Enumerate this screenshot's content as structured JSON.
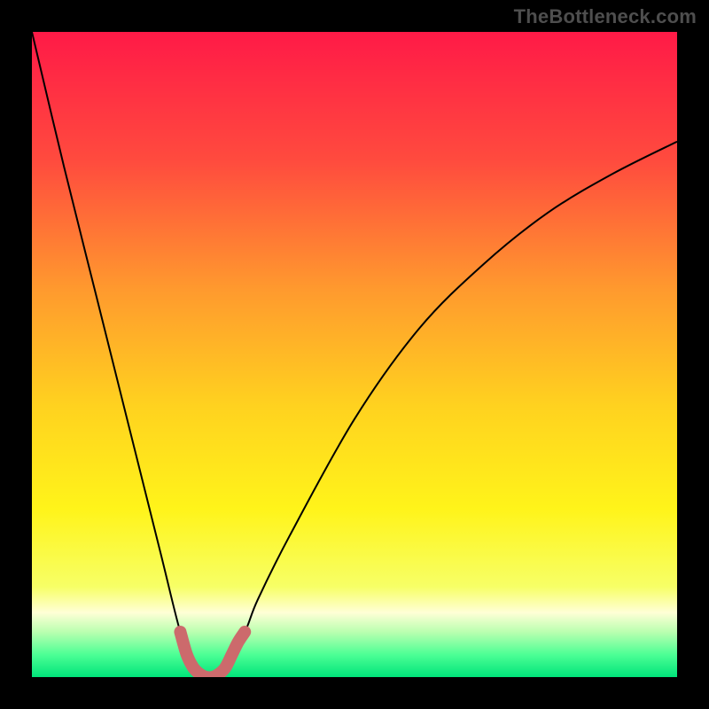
{
  "watermark": "TheBottleneck.com",
  "chart_data": {
    "type": "line",
    "title": "",
    "xlabel": "",
    "ylabel": "",
    "xlim": [
      0,
      100
    ],
    "ylim": [
      0,
      100
    ],
    "grid": false,
    "legend": false,
    "series": [
      {
        "name": "bottleneck-curve",
        "x": [
          0,
          5,
          10,
          15,
          20,
          23,
          25,
          27,
          30,
          33,
          35,
          40,
          50,
          60,
          70,
          80,
          90,
          100
        ],
        "y": [
          100,
          79,
          59,
          39,
          19,
          7,
          2,
          0,
          2,
          7,
          12,
          22,
          40,
          54,
          64,
          72,
          78,
          83
        ],
        "stroke": "#000000",
        "stroke_width": 2
      },
      {
        "name": "optimal-zone-marker",
        "x": [
          23,
          24,
          25,
          26,
          27,
          28,
          29,
          30,
          31,
          32,
          33
        ],
        "y": [
          7,
          3.5,
          1.5,
          0.5,
          0,
          0,
          0.5,
          1.5,
          3.5,
          5.5,
          7
        ],
        "stroke": "#cc6a6c",
        "stroke_width": 14
      }
    ],
    "background_gradient": {
      "type": "vertical",
      "stops": [
        {
          "offset": 0.0,
          "color": "#ff1a47"
        },
        {
          "offset": 0.2,
          "color": "#ff4b3e"
        },
        {
          "offset": 0.4,
          "color": "#ff9a2e"
        },
        {
          "offset": 0.58,
          "color": "#ffd21f"
        },
        {
          "offset": 0.74,
          "color": "#fff41a"
        },
        {
          "offset": 0.86,
          "color": "#f7ff66"
        },
        {
          "offset": 0.9,
          "color": "#ffffd6"
        },
        {
          "offset": 0.93,
          "color": "#baffb0"
        },
        {
          "offset": 0.965,
          "color": "#4dff95"
        },
        {
          "offset": 1.0,
          "color": "#00e47a"
        }
      ]
    }
  }
}
